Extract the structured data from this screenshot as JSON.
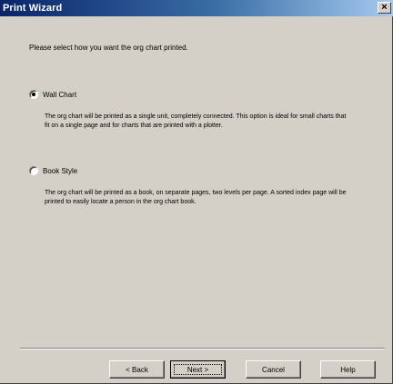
{
  "window": {
    "title": "Print Wizard",
    "close_glyph": "×"
  },
  "content": {
    "instruction": "Please select how you want the org chart printed.",
    "options": [
      {
        "label": "Wall Chart",
        "checked": true,
        "description": "The org chart will be printed as a single unit, completely connected. This option is ideal for small charts that fit on a single page and for charts that are printed with a plotter."
      },
      {
        "label": "Book Style",
        "checked": false,
        "description": "The org chart will be printed as a book, on separate pages, two levels per page. A sorted index page will be printed to easily locate a person in the org chart book."
      }
    ]
  },
  "buttons": {
    "back": "< Back",
    "next": "Next >",
    "cancel": "Cancel",
    "help": "Help"
  }
}
